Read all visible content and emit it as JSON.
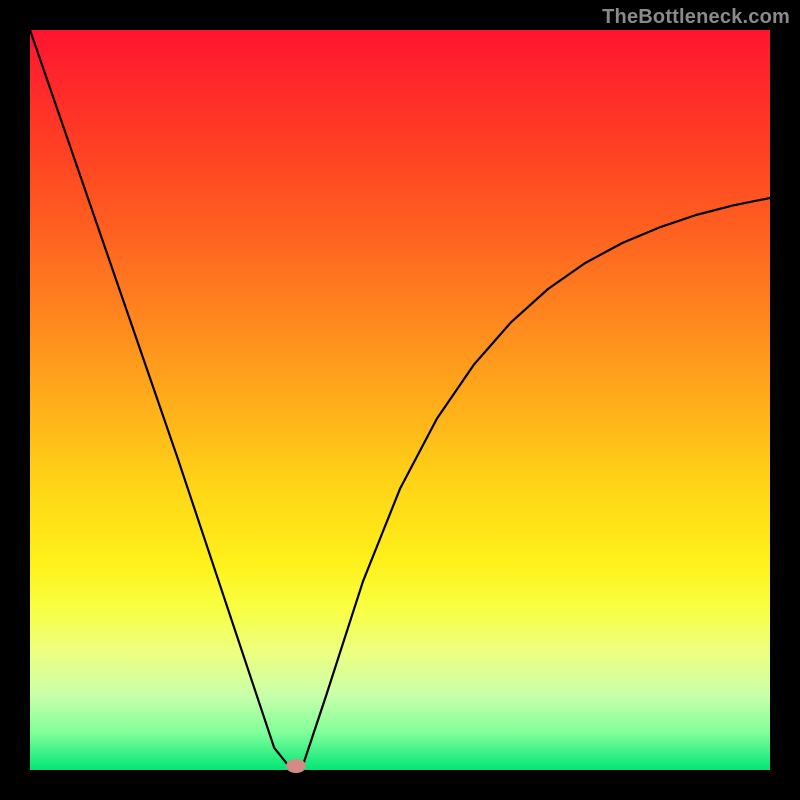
{
  "watermark": "TheBottleneck.com",
  "chart_data": {
    "type": "line",
    "title": "",
    "xlabel": "",
    "ylabel": "",
    "xlim": [
      0,
      100
    ],
    "ylim": [
      0,
      100
    ],
    "series": [
      {
        "name": "curve",
        "x": [
          0,
          5,
          10,
          15,
          20,
          25,
          30,
          33,
          35,
          36,
          37,
          40,
          45,
          50,
          55,
          60,
          65,
          70,
          75,
          80,
          85,
          90,
          95,
          100
        ],
        "values": [
          100,
          85.5,
          71,
          56.5,
          42,
          27,
          12,
          3,
          0.5,
          0,
          1,
          10,
          25.5,
          38,
          47.5,
          54.8,
          60.5,
          65,
          68.5,
          71.2,
          73.3,
          75,
          76.3,
          77.3
        ]
      }
    ],
    "marker": {
      "x": 36,
      "y": 0.5,
      "color": "#d58a86"
    },
    "gradient_stops": [
      {
        "pos": 0,
        "color": "#ff1530"
      },
      {
        "pos": 100,
        "color": "#00e676"
      }
    ]
  }
}
